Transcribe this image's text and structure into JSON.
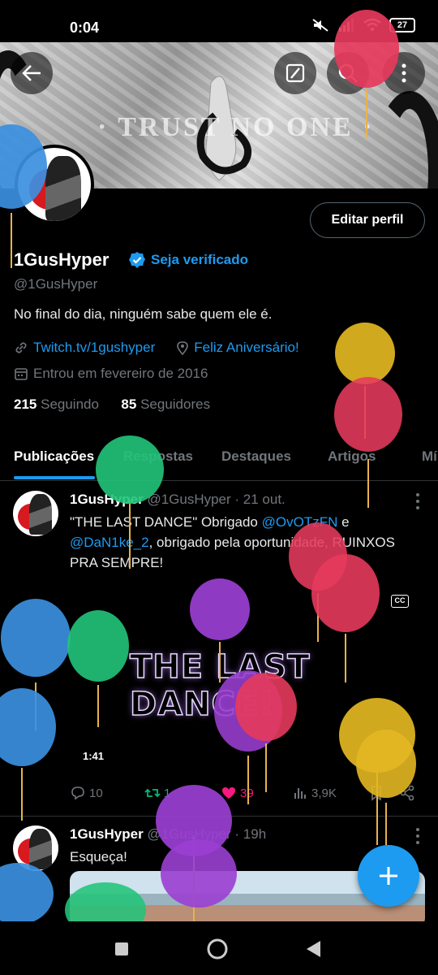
{
  "status_bar": {
    "time": "0:04",
    "battery": "27"
  },
  "banner": {
    "text": "· TRUST NO ONE ·"
  },
  "profile": {
    "name": "1GusHyper",
    "verify_link": "Seja verificado",
    "handle": "@1GusHyper",
    "bio": "No final do dia, ninguém sabe quem ele é.",
    "link": "Twitch.tv/1gushyper",
    "birthday": "Feliz Aniversário!",
    "joined": "Entrou em fevereiro de 2016",
    "following_count": "215",
    "following_label": "Seguindo",
    "followers_count": "85",
    "followers_label": "Seguidores",
    "edit_button": "Editar perfil"
  },
  "tabs": [
    {
      "label": "Publicações",
      "active": true
    },
    {
      "label": "Respostas"
    },
    {
      "label": "Destaques"
    },
    {
      "label": "Artigos"
    },
    {
      "label": "Mí"
    }
  ],
  "posts": [
    {
      "name": "1GusHyper",
      "handle_time": "@1GusHyper · 21 out.",
      "text_1": "\"THE LAST DANCE\" Obrigado ",
      "mention_1": "@OvOTzFN",
      "text_2": " e",
      "mention_2": "@DaN1ke_2",
      "text_3": ", obrigado pela oportunidade, RUINXOS PRA SEMPRE!",
      "media_title": "THE LAST DANCE!",
      "media_cc": "CC",
      "media_duration": "1:41",
      "replies": "10",
      "retweets": "1",
      "likes": "39",
      "views": "3,9K"
    },
    {
      "name": "1GusHyper",
      "handle_time": "@1GusHyper · 19h",
      "text": "Esqueça!"
    }
  ],
  "colors": {
    "accent": "#1d9bf0",
    "like": "#f91880",
    "retweet": "#00ba7c",
    "text_secondary": "#71767b"
  },
  "icons": [
    "back-arrow-icon",
    "grok-icon",
    "search-icon",
    "more-vertical-icon",
    "verified-badge-icon",
    "link-icon",
    "location-icon",
    "calendar-icon",
    "reply-icon",
    "retweet-icon",
    "heart-icon",
    "views-icon",
    "bookmark-icon",
    "share-icon",
    "plus-icon",
    "nav-recent-icon",
    "nav-home-icon",
    "nav-back-icon"
  ]
}
